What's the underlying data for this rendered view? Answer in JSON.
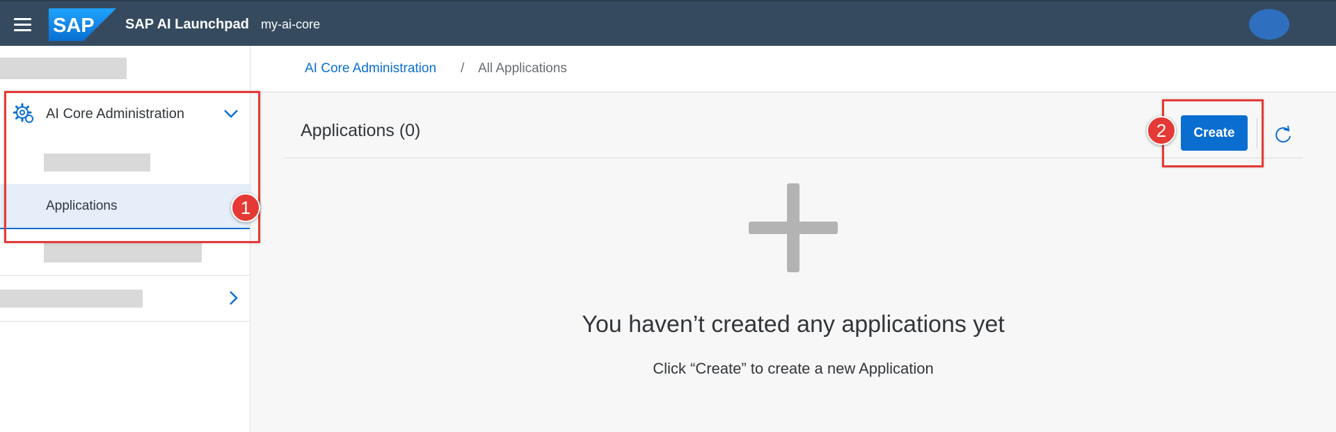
{
  "shellbar": {
    "logo_text": "SAP",
    "app_title": "SAP AI Launchpad",
    "instance": "my-ai-core",
    "brand_color": "#354a5f"
  },
  "sidebar": {
    "group_label": "AI Core Administration",
    "group_icon": "settings-cog-icon",
    "active_item": "Applications"
  },
  "breadcrumb": {
    "parent": "AI Core Administration",
    "separator": "/",
    "current": "All Applications"
  },
  "main": {
    "title": "Applications (0)",
    "create_label": "Create",
    "empty_title": "You haven’t created any applications yet",
    "empty_subtitle": "Click “Create” to create a new Application"
  },
  "annotations": {
    "badge_1": "1",
    "badge_2": "2",
    "color": "#e53935"
  }
}
